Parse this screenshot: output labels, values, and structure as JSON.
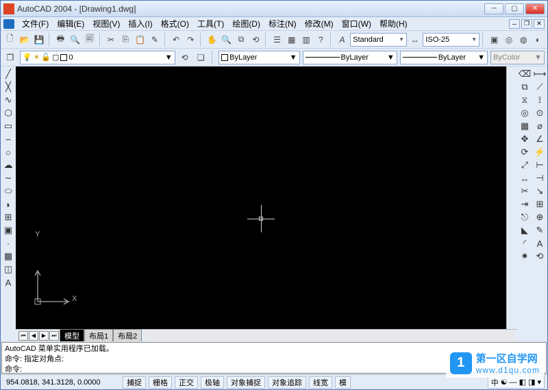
{
  "title": "AutoCAD 2004 - [Drawing1.dwg]",
  "menu": {
    "file": "文件(F)",
    "edit": "编辑(E)",
    "view": "视图(V)",
    "insert": "插入(I)",
    "format": "格式(O)",
    "tools": "工具(T)",
    "draw": "绘图(D)",
    "dimension": "标注(N)",
    "modify": "修改(M)",
    "window": "窗口(W)",
    "help": "帮助(H)"
  },
  "style_toolbar": {
    "text_style": "Standard",
    "dim_style": "ISO-25"
  },
  "layer": {
    "current": "0",
    "color_dropdown": "ByLayer",
    "linetype_dropdown": "ByLayer",
    "lineweight_dropdown": "ByLayer",
    "plotstyle_dropdown": "ByColor"
  },
  "ucs": {
    "x": "X",
    "y": "Y"
  },
  "tabs": {
    "model": "模型",
    "layout1": "布局1",
    "layout2": "布局2"
  },
  "cmd": {
    "line1": "AutoCAD 菜单实用程序已加载。",
    "line2": "命令: 指定对角点:",
    "prompt_label": "命令:",
    "prompt_value": ""
  },
  "status": {
    "coords": "954.0818, 341.3128, 0.0000",
    "snap": "捕捉",
    "grid": "栅格",
    "ortho": "正交",
    "polar": "极轴",
    "osnap": "对象捕捉",
    "otrack": "对象追踪",
    "lwt": "线宽",
    "model_btn": "模",
    "ime": "中"
  },
  "watermark": {
    "logo": "1",
    "title": "第一区自学网",
    "url": "www.d1qu.com"
  }
}
